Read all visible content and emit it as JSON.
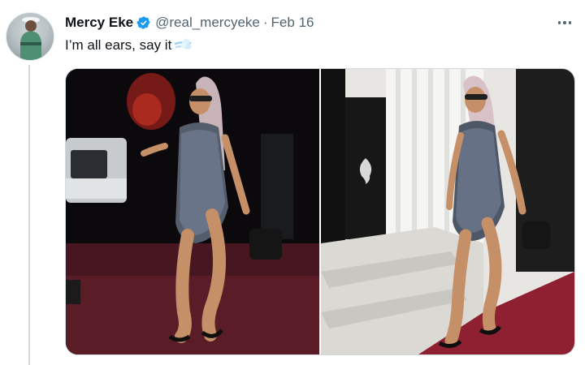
{
  "tweet": {
    "author_name": "Mercy Eke",
    "handle": "@real_mercyeke",
    "separator": "·",
    "date": "Feb 16",
    "text": "I’m all ears, say it",
    "emoji": "dashing-away-emoji",
    "verified": true,
    "verified_color": "#1d9bf0"
  },
  "media": {
    "photo_count": 2
  },
  "icons": {
    "verified": "verified-badge-icon",
    "more": "more-horizontal-icon"
  }
}
